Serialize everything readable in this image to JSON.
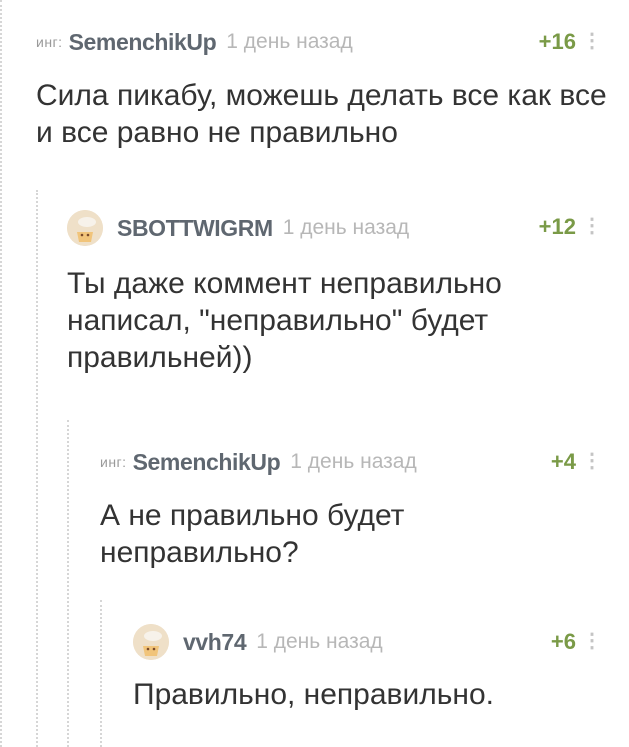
{
  "comments": [
    {
      "tag": "инг:",
      "author": "SemenchikUp",
      "time": "1 день назад",
      "rating": "+16",
      "lines": [
        "Сила пикабу, можешь делать все как все",
        "и все равно не правильно"
      ]
    },
    {
      "author": "SBOTTWIGRM",
      "time": "1 день назад",
      "rating": "+12",
      "lines": [
        "Ты даже коммент неправильно",
        "написал, \"неправильно\" будет",
        "правильней))"
      ]
    },
    {
      "tag": "инг:",
      "author": "SemenchikUp",
      "time": "1 день назад",
      "rating": "+4",
      "lines": [
        "А не правильно будет",
        "неправильно?"
      ]
    },
    {
      "author": "vvh74",
      "time": "1 день назад",
      "rating": "+6",
      "lines": [
        "Правильно, неправильно."
      ]
    }
  ],
  "icons": {
    "more": "more-vertical-icon",
    "avatar": "default-avatar-icon"
  },
  "colors": {
    "rating": "#7a9a47",
    "author": "#5f6770",
    "time": "#b7b7b7",
    "thread_line": "#d6d6d6"
  }
}
